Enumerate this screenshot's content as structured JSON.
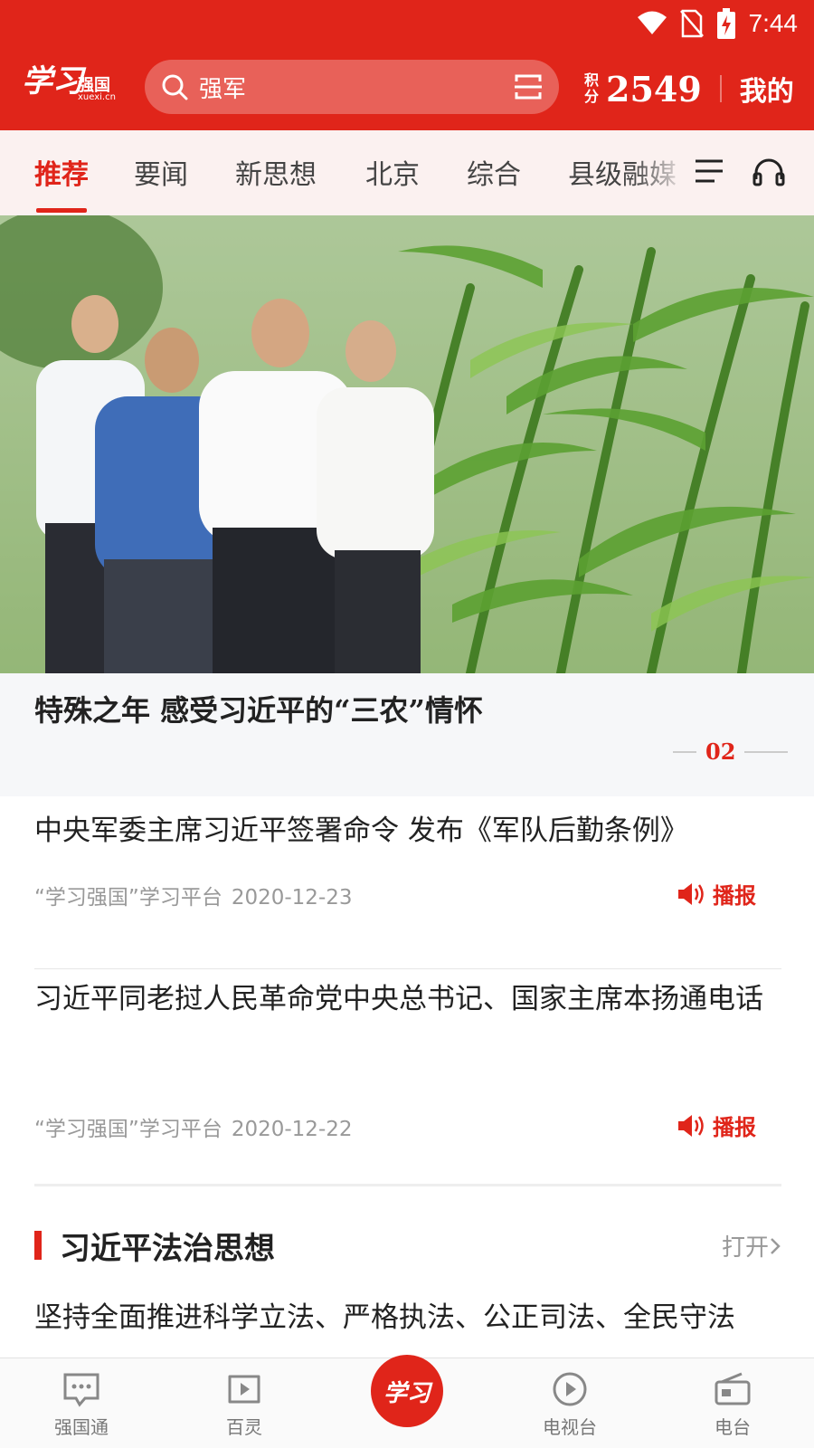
{
  "status_bar": {
    "time": "7:44"
  },
  "header": {
    "logo_script": "学习",
    "logo_name": "强国",
    "logo_domain": "xuexi.cn",
    "search_text": "强军",
    "score_label": "积分",
    "score_value": "2549",
    "mine_label": "我的"
  },
  "tabs": {
    "items": [
      {
        "label": "推荐"
      },
      {
        "label": "要闻"
      },
      {
        "label": "新思想"
      },
      {
        "label": "北京"
      },
      {
        "label": "综合"
      },
      {
        "label": "县级融媒"
      }
    ],
    "active_index": 0
  },
  "hero": {
    "title": "特殊之年 感受习近平的“三农”情怀",
    "page_indicator": "02"
  },
  "news": [
    {
      "title": "中央军委主席习近平签署命令 发布《军队后勤条例》",
      "source": "“学习强国”学习平台",
      "date": "2020-12-23",
      "action": "播报"
    },
    {
      "title": "习近平同老挝人民革命党中央总书记、国家主席本扬通电话",
      "source": "“学习强国”学习平台",
      "date": "2020-12-22",
      "action": "播报"
    }
  ],
  "section": {
    "title": "习近平法治思想",
    "open_label": "打开",
    "preview_text": "坚持全面推进科学立法、严格执法、公正司法、全民守法"
  },
  "bottom_nav": {
    "items": [
      {
        "label": "强国通"
      },
      {
        "label": "百灵"
      },
      {
        "label": "学习"
      },
      {
        "label": "电视台"
      },
      {
        "label": "电台"
      }
    ]
  },
  "colors": {
    "accent": "#e0251a",
    "tab_bg": "#fbf1f0",
    "muted": "#999999"
  },
  "icons": [
    "wifi-icon",
    "no-sim-icon",
    "battery-charging-icon",
    "search-icon",
    "scan-icon",
    "menu-icon",
    "headphones-icon",
    "speaker-icon",
    "chevron-right-icon",
    "chat-icon",
    "play-video-icon",
    "play-circle-icon",
    "radio-icon"
  ]
}
